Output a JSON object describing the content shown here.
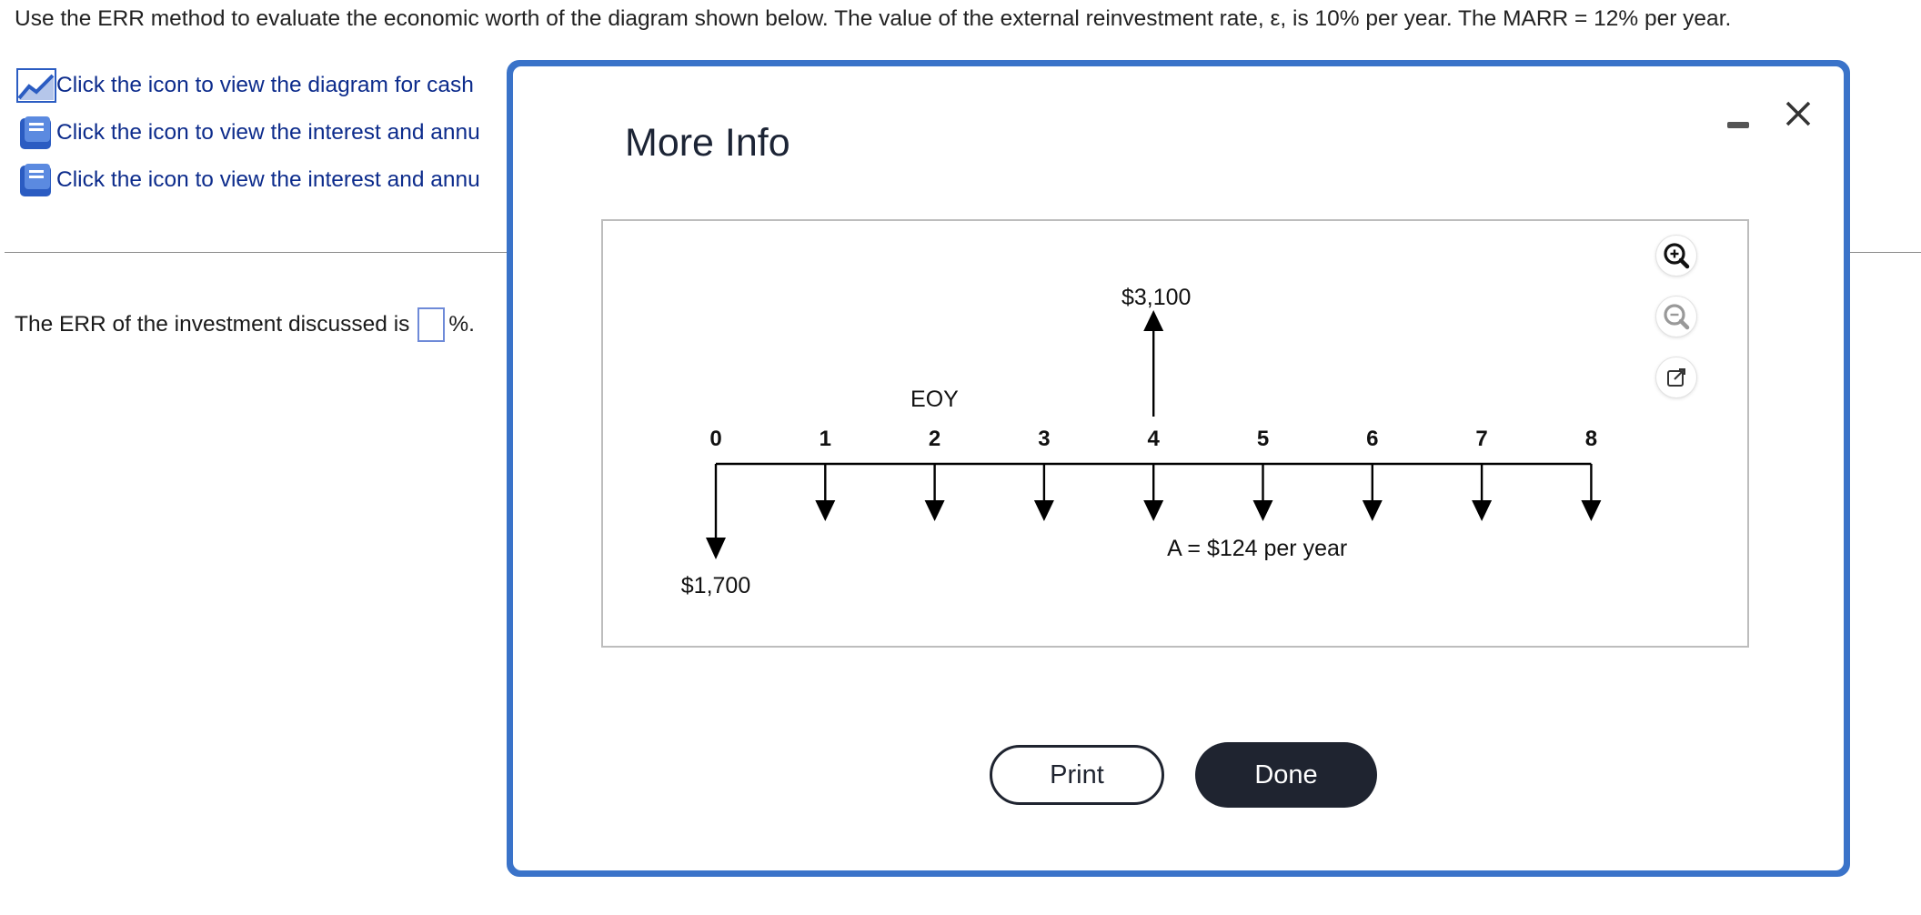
{
  "question": {
    "text": "Use the ERR method to evaluate the economic worth of the diagram shown below. The value of the external reinvestment rate, ε, is 10% per year. The MARR = 12% per year."
  },
  "links": [
    {
      "icon": "line-chart-icon",
      "label": "Click the icon to view the diagram for cash"
    },
    {
      "icon": "book-icon",
      "label": "Click the icon to view the interest and annu"
    },
    {
      "icon": "book-icon",
      "label": "Click the icon to view the interest and annu"
    }
  ],
  "answer": {
    "prefix": "The ERR of the investment discussed is",
    "suffix": "%.",
    "value": ""
  },
  "modal": {
    "title": "More Info",
    "print_label": "Print",
    "done_label": "Done",
    "minimize_icon": "minimize-icon",
    "close_icon": "close-icon",
    "tools": [
      "zoom-in-icon",
      "zoom-out-icon",
      "popout-icon"
    ]
  },
  "diagram": {
    "axis_label": "EOY",
    "periods": [
      "0",
      "1",
      "2",
      "3",
      "4",
      "5",
      "6",
      "7",
      "8"
    ],
    "initial_outflow_label": "$1,700",
    "inflow_label": "$3,100",
    "inflow_period": "4",
    "annuity_label": "A  =  $124 per year",
    "colors": {
      "line": "#000000",
      "frame": "#bdbdbd"
    }
  },
  "colors": {
    "accent": "#3a73c9",
    "link": "#0d2c8c",
    "button_dark": "#1f2430"
  }
}
